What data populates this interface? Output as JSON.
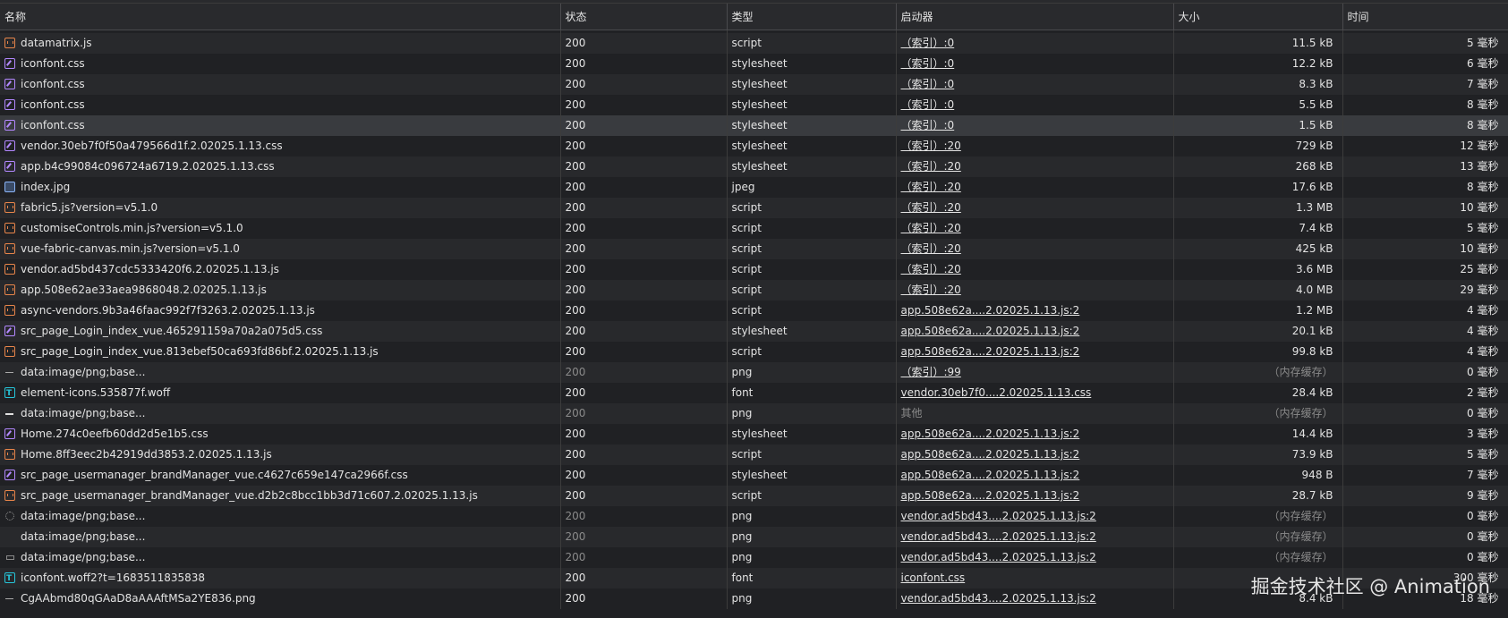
{
  "columns": {
    "name": "名称",
    "status": "状态",
    "type": "类型",
    "initiator": "启动器",
    "size": "大小",
    "time": "时间"
  },
  "rows": [
    {
      "name": "datamatrix.js",
      "icon": "script-icon",
      "status": "200",
      "type": "script",
      "initiator": "（索引）:0",
      "size": "11.5 kB",
      "time": "5 毫秒"
    },
    {
      "name": "iconfont.css",
      "icon": "stylesheet-icon",
      "status": "200",
      "type": "stylesheet",
      "initiator": "（索引）:0",
      "size": "12.2 kB",
      "time": "6 毫秒"
    },
    {
      "name": "iconfont.css",
      "icon": "stylesheet-icon",
      "status": "200",
      "type": "stylesheet",
      "initiator": "（索引）:0",
      "size": "8.3 kB",
      "time": "7 毫秒"
    },
    {
      "name": "iconfont.css",
      "icon": "stylesheet-icon",
      "status": "200",
      "type": "stylesheet",
      "initiator": "（索引）:0",
      "size": "5.5 kB",
      "time": "8 毫秒"
    },
    {
      "name": "iconfont.css",
      "icon": "stylesheet-icon",
      "status": "200",
      "type": "stylesheet",
      "initiator": "（索引）:0",
      "size": "1.5 kB",
      "time": "8 毫秒",
      "selected": true
    },
    {
      "name": "vendor.30eb7f0f50a479566d1f.2.02025.1.13.css",
      "icon": "stylesheet-icon",
      "status": "200",
      "type": "stylesheet",
      "initiator": "（索引）:20",
      "size": "729 kB",
      "time": "12 毫秒"
    },
    {
      "name": "app.b4c99084c096724a6719.2.02025.1.13.css",
      "icon": "stylesheet-icon",
      "status": "200",
      "type": "stylesheet",
      "initiator": "（索引）:20",
      "size": "268 kB",
      "time": "13 毫秒"
    },
    {
      "name": "index.jpg",
      "icon": "image-icon",
      "status": "200",
      "type": "jpeg",
      "initiator": "（索引）:20",
      "size": "17.6 kB",
      "time": "8 毫秒"
    },
    {
      "name": "fabric5.js?version=v5.1.0",
      "icon": "script-icon",
      "status": "200",
      "type": "script",
      "initiator": "（索引）:20",
      "size": "1.3 MB",
      "time": "10 毫秒"
    },
    {
      "name": "customiseControls.min.js?version=v5.1.0",
      "icon": "script-icon",
      "status": "200",
      "type": "script",
      "initiator": "（索引）:20",
      "size": "7.4 kB",
      "time": "5 毫秒"
    },
    {
      "name": "vue-fabric-canvas.min.js?version=v5.1.0",
      "icon": "script-icon",
      "status": "200",
      "type": "script",
      "initiator": "（索引）:20",
      "size": "425 kB",
      "time": "10 毫秒"
    },
    {
      "name": "vendor.ad5bd437cdc5333420f6.2.02025.1.13.js",
      "icon": "script-icon",
      "status": "200",
      "type": "script",
      "initiator": "（索引）:20",
      "size": "3.6 MB",
      "time": "25 毫秒"
    },
    {
      "name": "app.508e62ae33aea9868048.2.02025.1.13.js",
      "icon": "script-icon",
      "status": "200",
      "type": "script",
      "initiator": "（索引）:20",
      "size": "4.0 MB",
      "time": "29 毫秒"
    },
    {
      "name": "async-vendors.9b3a46faac992f7f3263.2.02025.1.13.js",
      "icon": "script-icon",
      "status": "200",
      "type": "script",
      "initiator": "app.508e62a....2.02025.1.13.js:2",
      "size": "1.2 MB",
      "time": "4 毫秒"
    },
    {
      "name": "src_page_Login_index_vue.465291159a70a2a075d5.css",
      "icon": "stylesheet-icon",
      "status": "200",
      "type": "stylesheet",
      "initiator": "app.508e62a....2.02025.1.13.js:2",
      "size": "20.1 kB",
      "time": "4 毫秒"
    },
    {
      "name": "src_page_Login_index_vue.813ebef50ca693fd86bf.2.02025.1.13.js",
      "icon": "script-icon",
      "status": "200",
      "type": "script",
      "initiator": "app.508e62a....2.02025.1.13.js:2",
      "size": "99.8 kB",
      "time": "4 毫秒"
    },
    {
      "name": "data:image/png;base...",
      "icon": "dash-icon",
      "status": "200",
      "dim": true,
      "type": "png",
      "initiator": "（索引）:99",
      "size": "（内存缓存）",
      "sizeDim": true,
      "time": "0 毫秒"
    },
    {
      "name": "element-icons.535877f.woff",
      "icon": "font-icon",
      "status": "200",
      "type": "font",
      "initiator": "vendor.30eb7f0....2.02025.1.13.css",
      "size": "28.4 kB",
      "time": "2 毫秒"
    },
    {
      "name": "data:image/png;base...",
      "icon": "dash-bold-icon",
      "status": "200",
      "dim": true,
      "type": "png",
      "initiator": "其他",
      "initiatorPlain": true,
      "size": "（内存缓存）",
      "sizeDim": true,
      "time": "0 毫秒"
    },
    {
      "name": "Home.274c0eefb60dd2d5e1b5.css",
      "icon": "stylesheet-icon",
      "status": "200",
      "type": "stylesheet",
      "initiator": "app.508e62a....2.02025.1.13.js:2",
      "size": "14.4 kB",
      "time": "3 毫秒"
    },
    {
      "name": "Home.8ff3eec2b42919dd3853.2.02025.1.13.js",
      "icon": "script-icon",
      "status": "200",
      "type": "script",
      "initiator": "app.508e62a....2.02025.1.13.js:2",
      "size": "73.9 kB",
      "time": "5 毫秒"
    },
    {
      "name": "src_page_usermanager_brandManager_vue.c4627c659e147ca2966f.css",
      "icon": "stylesheet-icon",
      "status": "200",
      "type": "stylesheet",
      "initiator": "app.508e62a....2.02025.1.13.js:2",
      "size": "948 B",
      "time": "7 毫秒"
    },
    {
      "name": "src_page_usermanager_brandManager_vue.d2b2c8bcc1bb3d71c607.2.02025.1.13.js",
      "icon": "script-icon",
      "status": "200",
      "type": "script",
      "initiator": "app.508e62a....2.02025.1.13.js:2",
      "size": "28.7 kB",
      "time": "9 毫秒"
    },
    {
      "name": "data:image/png;base...",
      "icon": "dotted-circle-icon",
      "status": "200",
      "dim": true,
      "type": "png",
      "initiator": "vendor.ad5bd43....2.02025.1.13.js:2",
      "size": "（内存缓存）",
      "sizeDim": true,
      "time": "0 毫秒"
    },
    {
      "name": "data:image/png;base...",
      "icon": "blank-icon",
      "status": "200",
      "dim": true,
      "type": "png",
      "initiator": "vendor.ad5bd43....2.02025.1.13.js:2",
      "size": "（内存缓存）",
      "sizeDim": true,
      "time": "0 毫秒"
    },
    {
      "name": "data:image/png;base...",
      "icon": "small-image-icon",
      "status": "200",
      "dim": true,
      "type": "png",
      "initiator": "vendor.ad5bd43....2.02025.1.13.js:2",
      "size": "（内存缓存）",
      "sizeDim": true,
      "time": "0 毫秒"
    },
    {
      "name": "iconfont.woff2?t=1683511835838",
      "icon": "font-icon",
      "status": "200",
      "type": "font",
      "initiator": "iconfont.css",
      "size": "",
      "time": "300 毫秒"
    },
    {
      "name": "CgAAbmd80qGAaD8aAAAftMSa2YE836.png",
      "icon": "dash-icon",
      "status": "200",
      "type": "png",
      "initiator": "vendor.ad5bd43....2.02025.1.13.js:2",
      "size": "8.4 kB",
      "time": "18 毫秒"
    }
  ],
  "watermark": "掘金技术社区 @ Animation"
}
